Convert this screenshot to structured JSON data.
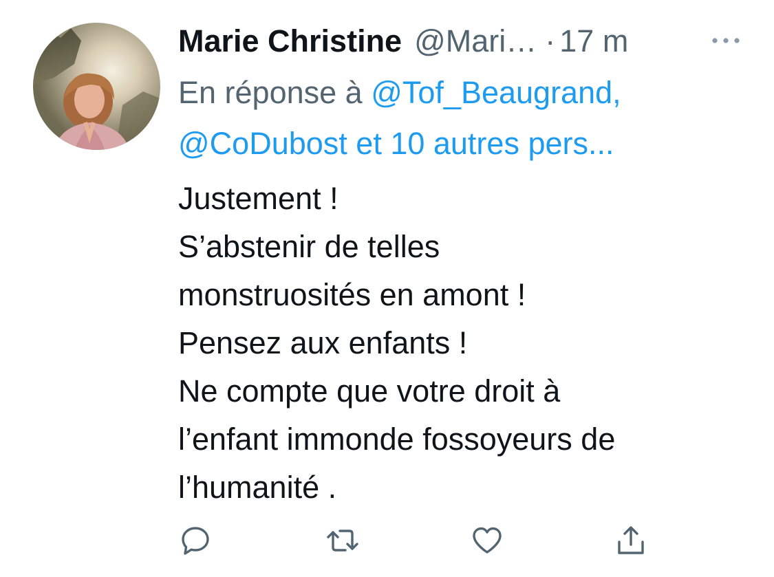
{
  "tweet": {
    "author": {
      "display_name": "Marie Christine",
      "handle": "@Mari…",
      "separator": "·",
      "time": "17 m"
    },
    "more_icon": "more-horizontal-icon",
    "reply_context": {
      "prefix": "En réponse à ",
      "mention_1": "@Tof_Beaugrand,",
      "mention_2": "@CoDubost et 10 autres pers..."
    },
    "text_lines": [
      "Justement !",
      "S’abstenir de telles",
      "monstruosités en amont !",
      "Pensez aux enfants !",
      "Ne compte que votre droit à",
      "l’enfant immonde fossoyeurs de",
      "l’humanité ."
    ],
    "actions": [
      "reply-icon",
      "retweet-icon",
      "like-icon",
      "share-icon"
    ],
    "colors": {
      "text": "#0f1419",
      "secondary": "#536471",
      "link": "#1d9bf0"
    }
  }
}
